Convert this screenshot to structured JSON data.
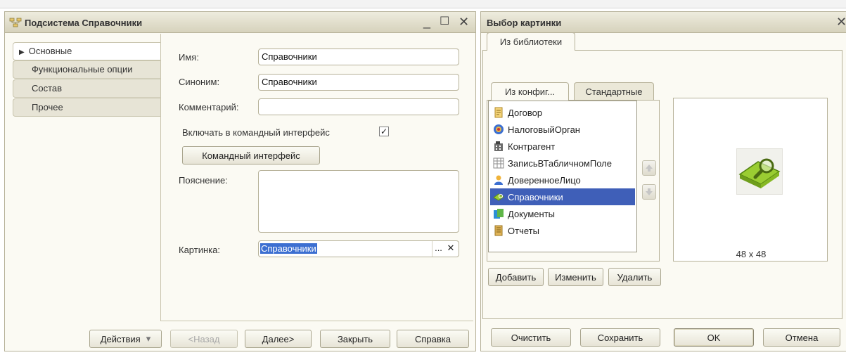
{
  "subsystem_window": {
    "title": "Подсистема Справочники",
    "controls": {
      "minimize": "_",
      "maximize": "☐",
      "close": "✕"
    },
    "nav": {
      "items": [
        {
          "label": "Основные",
          "active": true,
          "marker": "▶"
        },
        {
          "label": "Функциональные опции"
        },
        {
          "label": "Состав"
        },
        {
          "label": "Прочее"
        }
      ]
    },
    "form": {
      "name_label": "Имя:",
      "name_value": "Справочники",
      "synonym_label": "Синоним:",
      "synonym_value": "Справочники",
      "comment_label": "Комментарий:",
      "comment_value": "",
      "include_label": "Включать в командный интерфейс",
      "include_checked": "✓",
      "command_interface_button": "Командный интерфейс",
      "explanation_label": "Пояснение:",
      "picture_label": "Картинка:",
      "picture_value": "Справочники",
      "picture_select": "...",
      "picture_clear": "✕"
    },
    "footer": {
      "actions": "Действия",
      "actions_arrow": "▾",
      "back": "<Назад",
      "next": "Далее>",
      "close": "Закрыть",
      "help": "Справка"
    }
  },
  "picture_window": {
    "title": "Выбор картинки",
    "close": "✕",
    "tabs": [
      {
        "label": "Из библиотеки",
        "active": true
      }
    ],
    "inner_tabs": [
      {
        "label": "Из конфиг...",
        "active": true
      },
      {
        "label": "Стандартные"
      }
    ],
    "list": [
      {
        "label": "Договор",
        "icon": "document-icon",
        "color": "#d9a93b"
      },
      {
        "label": "НалоговыйОрган",
        "icon": "emblem-icon",
        "color": "#3c6fd1"
      },
      {
        "label": "Контрагент",
        "icon": "building-icon",
        "color": "#5b5b5b"
      },
      {
        "label": "ЗаписьВТабличномПоле",
        "icon": "table-icon",
        "color": "#8a8a8a"
      },
      {
        "label": "ДоверенноеЛицо",
        "icon": "person-icon",
        "color": "#e0a020"
      },
      {
        "label": "Справочники",
        "icon": "catalog-book-icon",
        "color": "#9acd32",
        "selected": true
      },
      {
        "label": "Документы",
        "icon": "documents-icon",
        "color": "#2c8fd6"
      },
      {
        "label": "Отчеты",
        "icon": "reports-icon",
        "color": "#c8962c"
      }
    ],
    "list_buttons": {
      "add": "Добавить",
      "edit": "Изменить",
      "delete": "Удалить"
    },
    "preview": {
      "size": "48 x 48",
      "icon": "catalog-book-magnifier-icon"
    },
    "footer": {
      "clear": "Очистить",
      "save": "Сохранить",
      "ok": "OK",
      "cancel": "Отмена"
    }
  }
}
